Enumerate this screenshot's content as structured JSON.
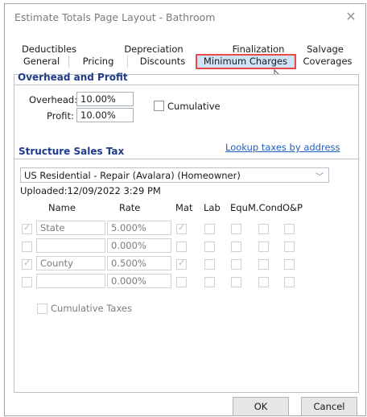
{
  "window": {
    "title": "Estimate Totals Page Layout - Bathroom",
    "close_glyph": "✕"
  },
  "tabs": {
    "row1": [
      "Deductibles",
      "Depreciation",
      "Finalization",
      "Salvage"
    ],
    "row2": [
      "General",
      "Pricing",
      "Discounts",
      "Minimum Charges",
      "Coverages"
    ],
    "active": "General",
    "highlighted": "Minimum Charges"
  },
  "overhead": {
    "heading": "Overhead and Profit",
    "overhead_label": "Overhead:",
    "overhead_value": "10.00%",
    "profit_label": "Profit:",
    "profit_value": "10.00%",
    "cumulative_label": "Cumulative"
  },
  "tax": {
    "heading": "Structure Sales Tax",
    "lookup_link": "Lookup taxes by address",
    "select_value": "US Residential - Repair (Avalara) (Homeowner)",
    "uploaded": "Uploaded:12/09/2022 3:29 PM",
    "headers": {
      "name": "Name",
      "rate": "Rate",
      "mat": "Mat",
      "lab": "Lab",
      "equ": "Equ",
      "mcond": "M.Cond",
      "op": "O&P"
    },
    "rows": [
      {
        "checked": true,
        "name": "State",
        "rate": "5.000%",
        "mat": true
      },
      {
        "checked": false,
        "name": "",
        "rate": "0.000%",
        "mat": false
      },
      {
        "checked": true,
        "name": "County",
        "rate": "0.500%",
        "mat": true
      },
      {
        "checked": false,
        "name": "",
        "rate": "0.000%",
        "mat": false
      }
    ],
    "cumulative_taxes_label": "Cumulative Taxes"
  },
  "buttons": {
    "ok": "OK",
    "cancel": "Cancel"
  },
  "colors": {
    "section_heading": "#1f3b8a",
    "link": "#1f5fbf",
    "tab_highlight": "#e84a4a"
  }
}
